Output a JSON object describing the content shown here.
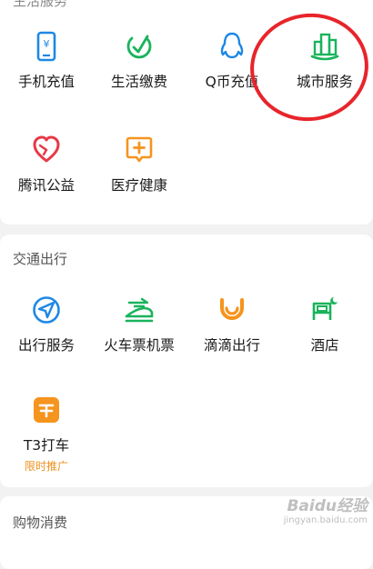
{
  "sections": {
    "life": {
      "title": "生活服务",
      "items": [
        {
          "label": "手机充值",
          "icon": "mobile-yuan-icon"
        },
        {
          "label": "生活缴费",
          "icon": "checkmark-bill-icon"
        },
        {
          "label": "Q币充值",
          "icon": "qq-penguin-icon"
        },
        {
          "label": "城市服务",
          "icon": "city-buildings-icon"
        },
        {
          "label": "腾讯公益",
          "icon": "heart-charity-icon"
        },
        {
          "label": "医疗健康",
          "icon": "medical-plus-icon"
        }
      ]
    },
    "transport": {
      "title": "交通出行",
      "items": [
        {
          "label": "出行服务",
          "icon": "navigation-arrow-icon"
        },
        {
          "label": "火车票机票",
          "icon": "train-icon"
        },
        {
          "label": "滴滴出行",
          "icon": "didi-icon"
        },
        {
          "label": "酒店",
          "icon": "hotel-bed-icon"
        },
        {
          "label": "T3打车",
          "icon": "t3-taxi-icon",
          "sublabel": "限时推广"
        }
      ]
    },
    "shopping": {
      "title": "购物消费"
    }
  },
  "colors": {
    "blue": "#1e88e5",
    "green": "#19b35b",
    "orange": "#f5941e",
    "red": "#e63946",
    "annotation": "#e8242b"
  },
  "watermark": {
    "main": "Baidu经验",
    "sub": "jingyan.baidu.com"
  }
}
